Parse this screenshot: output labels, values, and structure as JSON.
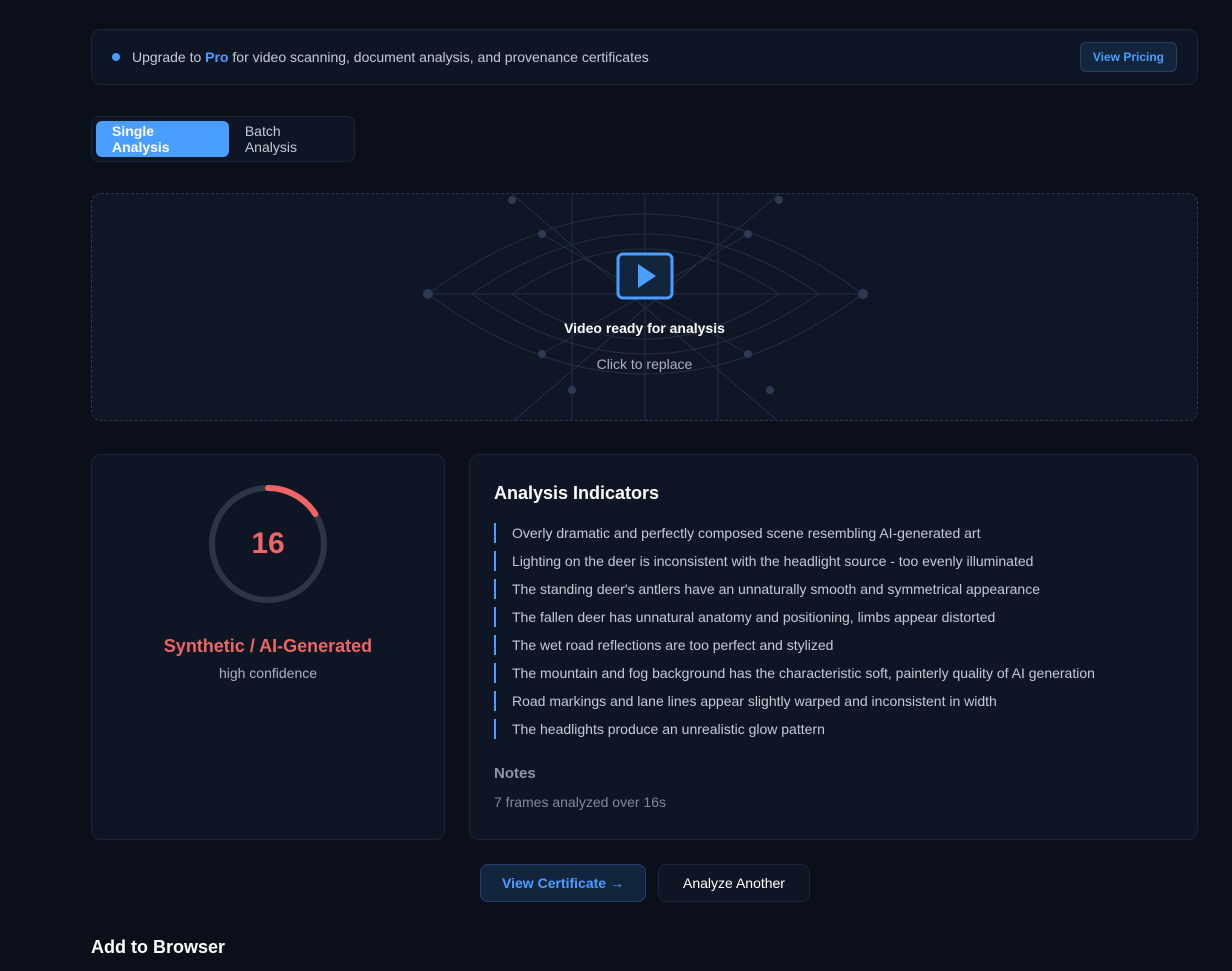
{
  "banner": {
    "prefix": "Upgrade to ",
    "pro": "Pro",
    "suffix": " for video scanning, document analysis, and provenance certificates",
    "button": "View Pricing"
  },
  "tabs": [
    {
      "label": "Single Analysis",
      "active": true
    },
    {
      "label": "Batch Analysis",
      "active": false
    }
  ],
  "upload": {
    "icon": "video-play-icon",
    "status": "Video ready for analysis",
    "hint": "Click to replace"
  },
  "result": {
    "score": "16",
    "score_fraction": 0.16,
    "verdict": "Synthetic / AI-Generated",
    "confidence": "high confidence",
    "verdict_color": "#ef6464"
  },
  "indicators": {
    "title": "Analysis Indicators",
    "items": [
      "Overly dramatic and perfectly composed scene resembling AI-generated art",
      "Lighting on the deer is inconsistent with the headlight source - too evenly illuminated",
      "The standing deer's antlers have an unnaturally smooth and symmetrical appearance",
      "The fallen deer has unnatural anatomy and positioning, limbs appear distorted",
      "The wet road reflections are too perfect and stylized",
      "The mountain and fog background has the characteristic soft, painterly quality of AI generation",
      "Road markings and lane lines appear slightly warped and inconsistent in width",
      "The headlights produce an unrealistic glow pattern"
    ],
    "notes_title": "Notes",
    "notes_text": "7 frames analyzed over 16s"
  },
  "actions": {
    "certificate": "View Certificate →",
    "analyze_another": "Analyze Another"
  },
  "footer": {
    "add_to_browser": "Add to Browser"
  },
  "colors": {
    "accent": "#4a9eff",
    "danger": "#ef6464",
    "background": "#0a0f1a"
  }
}
